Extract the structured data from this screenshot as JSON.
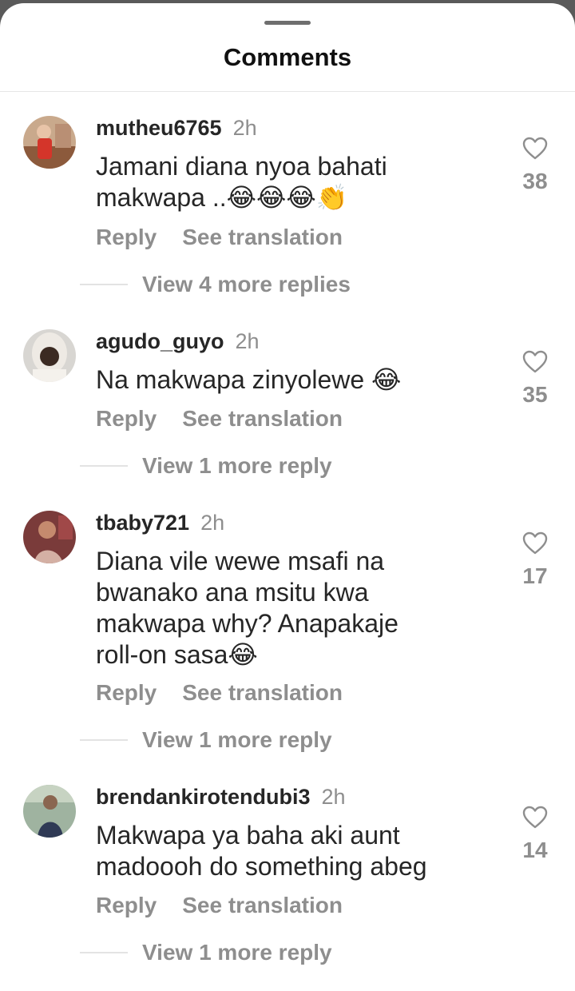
{
  "header": {
    "title": "Comments"
  },
  "actions": {
    "reply_label": "Reply",
    "translate_label": "See translation"
  },
  "comments": [
    {
      "username": "mutheu6765",
      "time": "2h",
      "text": "Jamani diana nyoa bahati\nmakwapa ..😂😂😂👏",
      "likes": "38",
      "view_more": "View 4 more replies"
    },
    {
      "username": "agudo_guyo",
      "time": "2h",
      "text": "Na makwapa zinyolewe 😂",
      "likes": "35",
      "view_more": "View 1 more reply"
    },
    {
      "username": "tbaby721",
      "time": "2h",
      "text": "Diana vile wewe msafi na\nbwanako ana msitu kwa\nmakwapa why? Anapakaje\nroll-on sasa😂",
      "likes": "17",
      "view_more": "View 1 more reply"
    },
    {
      "username": "brendankirotendubi3",
      "time": "2h",
      "text": "Makwapa ya baha aki aunt\nmadoooh do something abeg",
      "likes": "14",
      "view_more": "View 1 more reply"
    }
  ],
  "colors": {
    "text_primary": "#262626",
    "text_secondary": "#8e8e8e",
    "background": "#ffffff"
  },
  "icons": {
    "like": "heart-outline-icon"
  }
}
